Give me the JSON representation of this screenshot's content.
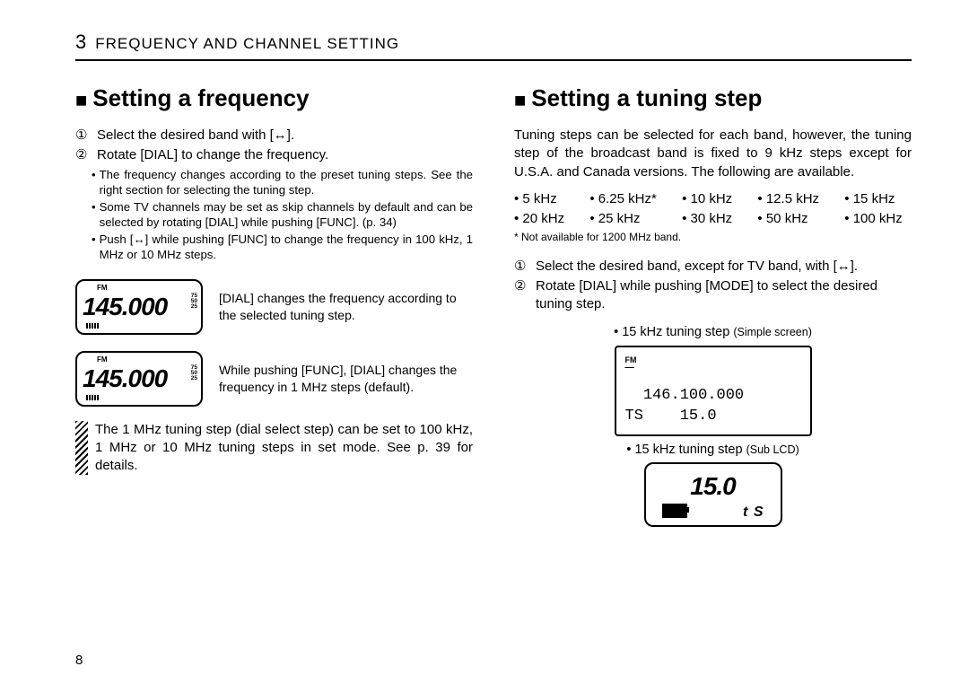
{
  "header": {
    "chapter_num": "3",
    "chapter_title": "FREQUENCY AND CHANNEL SETTING"
  },
  "left": {
    "title": "Setting a frequency",
    "step1_mark": "①",
    "step1": "Select the desired band with [↔].",
    "step2_mark": "②",
    "step2": "Rotate [DIAL] to change the frequency.",
    "sub1": "The frequency changes according to the preset tuning steps. See the right section for selecting the tuning step.",
    "sub2": "Some TV channels may be set as skip channels by default and can be selected by rotating [DIAL] while pushing [FUNC]. (p. 34)",
    "sub3": "Push [↔] while pushing [FUNC] to change the frequency in 100 kHz, 1 MHz or 10 MHz steps.",
    "lcd1": {
      "fm": "FM",
      "freq": "145.000",
      "scale": "75\n50\n25",
      "caption": "[DIAL] changes the frequency according to the selected tuning step."
    },
    "lcd2": {
      "fm": "FM",
      "freq": "145.000",
      "scale": "75\n50\n25",
      "caption": "While pushing [FUNC], [DIAL] changes the frequency in 1 MHz steps (default)."
    },
    "note": "The 1 MHz tuning step (dial select step) can be set to 100 kHz, 1 MHz or 10 MHz tuning steps in set mode. See p. 39 for details."
  },
  "right": {
    "title": "Setting a tuning step",
    "intro": "Tuning steps can be selected for each band, however, the tuning step of the broadcast band is fixed to 9 kHz steps except for U.S.A. and Canada versions. The following are available.",
    "steps": [
      "• 5 kHz",
      "• 6.25 kHz*",
      "• 10 kHz",
      "• 12.5 kHz",
      "• 15 kHz",
      "• 20 kHz",
      "• 25 kHz",
      "• 30 kHz",
      "• 50 kHz",
      "• 100 kHz"
    ],
    "ts_note": "* Not available for 1200 MHz band.",
    "step1_mark": "①",
    "step1": "Select the desired band, except for TV band, with [↔].",
    "step2_mark": "②",
    "step2": "Rotate [DIAL] while pushing [MODE] to select the desired tuning step.",
    "cap1a": "• 15 kHz tuning step ",
    "cap1b": "(Simple screen)",
    "simple": {
      "fm": "FM",
      "line1": "  146.100.000",
      "line2": "TS    15.0"
    },
    "cap2a": "• 15 kHz tuning step ",
    "cap2b": "(Sub LCD)",
    "sublcd": {
      "main": "15.0",
      "ts": "t S"
    }
  },
  "page_number": "8"
}
